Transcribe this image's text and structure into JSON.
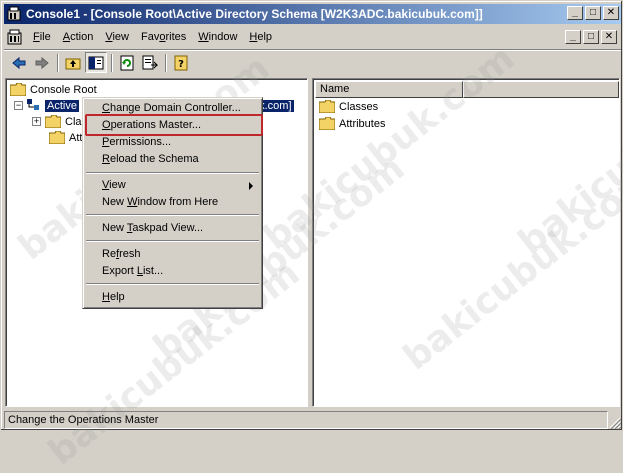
{
  "window": {
    "title": "Console1 - [Console Root\\Active Directory Schema [W2K3ADC.bakicubuk.com]]",
    "minimize": "_",
    "maximize": "□",
    "close": "✕"
  },
  "menubar": {
    "items": [
      {
        "pre": "",
        "accel": "F",
        "post": "ile"
      },
      {
        "pre": "",
        "accel": "A",
        "post": "ction"
      },
      {
        "pre": "",
        "accel": "V",
        "post": "iew"
      },
      {
        "pre": "Fav",
        "accel": "o",
        "post": "rites"
      },
      {
        "pre": "",
        "accel": "W",
        "post": "indow"
      },
      {
        "pre": "",
        "accel": "H",
        "post": "elp"
      }
    ]
  },
  "tree": {
    "root": "Console Root",
    "node_visible": "Active",
    "node_tail": "uk.com]",
    "child1": "Cla",
    "child2": "Attr",
    "expander_root": "−",
    "expander_child": "+"
  },
  "list": {
    "column_name": "Name",
    "items": [
      "Classes",
      "Attributes"
    ]
  },
  "context_menu": {
    "items": [
      {
        "pre": "",
        "accel": "C",
        "post": "hange Domain Controller..."
      },
      {
        "pre": "",
        "accel": "O",
        "post": "perations Master..."
      },
      {
        "pre": "",
        "accel": "P",
        "post": "ermissions..."
      },
      {
        "pre": "",
        "accel": "R",
        "post": "eload the Schema"
      },
      {
        "pre": "",
        "accel": "V",
        "post": "iew"
      },
      {
        "pre": "New ",
        "accel": "W",
        "post": "indow from Here"
      },
      {
        "pre": "New ",
        "accel": "T",
        "post": "askpad View..."
      },
      {
        "pre": "Re",
        "accel": "f",
        "post": "resh"
      },
      {
        "pre": "Export ",
        "accel": "L",
        "post": "ist..."
      },
      {
        "pre": "",
        "accel": "H",
        "post": "elp"
      }
    ]
  },
  "statusbar": {
    "text": "Change the Operations Master"
  },
  "watermark": "bakicubuk.com",
  "colors": {
    "title_start": "#0a246a",
    "title_end": "#a6caf0",
    "selection": "#0a246a",
    "highlight_box": "#c0272d",
    "folder": "#f3d266"
  }
}
